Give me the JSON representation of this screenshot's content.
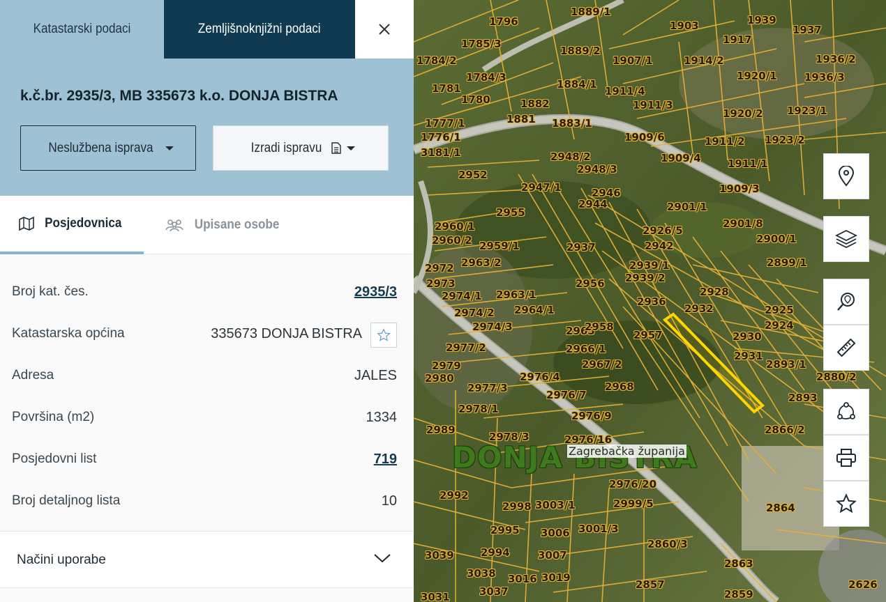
{
  "tabs": {
    "cadastral": "Katastarski podaci",
    "land_registry": "Zemljišnoknjižni podaci"
  },
  "parcel": {
    "title": "k.č.br. 2935/3, MB 335673 k.o. DONJA BISTRA"
  },
  "actions": {
    "unofficial_doc": "Neslužbena isprava",
    "create_doc": "Izradi ispravu"
  },
  "subtabs": {
    "possession": "Posjedovnica",
    "persons": "Upisane osobe"
  },
  "info": {
    "rows": [
      {
        "label": "Broj kat. čes.",
        "value": "2935/3"
      },
      {
        "label": "Katastarska općina",
        "value": "335673 DONJA BISTRA"
      },
      {
        "label": "Adresa",
        "value": "JALES"
      },
      {
        "label": "Površina (m2)",
        "value": "1334"
      },
      {
        "label": "Posjedovni list",
        "value": "719"
      },
      {
        "label": "Broj detaljnog lista",
        "value": "10"
      }
    ]
  },
  "accordion": {
    "usage_label": "Načini uporabe"
  },
  "map": {
    "town_label": "DONJA BISTRA",
    "county_label": "Zagrebačka županija",
    "parcel_labels": [
      "1796",
      "1889/1",
      "1903",
      "1939",
      "1937",
      "1785/3",
      "1889/2",
      "1907/1",
      "1914/2",
      "1917",
      "1936/2",
      "1784/2",
      "1784/3",
      "1884/1",
      "1911/4",
      "1920/1",
      "1936/3",
      "1781",
      "1780",
      "1882",
      "1911/3",
      "1920/2",
      "1923/1",
      "1777/1",
      "1881",
      "1883/1",
      "1909/6",
      "1911/2",
      "1923/2",
      "1776/1",
      "3181/1",
      "2948/2",
      "1909/4",
      "1911/1",
      "2952",
      "2948/3",
      "1909/3",
      "2947/1",
      "2946",
      "2901/1",
      "2944",
      "2955",
      "2926/5",
      "2901/8",
      "2960/1",
      "2942",
      "2900/1",
      "2960/2",
      "2959/1",
      "2937",
      "2963/2",
      "2939/1",
      "2899/1",
      "2972",
      "2939/2",
      "2973",
      "2956",
      "2928",
      "2974/1",
      "2963/1",
      "2936",
      "2932",
      "2925",
      "2974/2",
      "2964/1",
      "2924",
      "2974/3",
      "2965",
      "2958",
      "2957",
      "2930",
      "2977/2",
      "2966/1",
      "2931",
      "2893/1",
      "2979",
      "2967/2",
      "2980",
      "2976/4",
      "2880/2",
      "2968",
      "2977/3",
      "2976/7",
      "2893",
      "2978/1",
      "2976/9",
      "2989",
      "2978/3",
      "2976/16",
      "2866/2",
      "2976/20",
      "2992",
      "2998",
      "3003/1",
      "2999/5",
      "2864",
      "2995",
      "3006",
      "3001/3",
      "2860/3",
      "3039",
      "2994",
      "3007",
      "2863",
      "3038",
      "3016",
      "3019",
      "2857",
      "2626",
      "3031",
      "3037",
      "2859"
    ],
    "colors": {
      "parcel_line": "#e8b033",
      "selected_parcel": "#ffd400"
    }
  },
  "toolbar": {
    "icons": [
      "location-pin-icon",
      "layers-icon",
      "search-location-icon",
      "ruler-icon",
      "polygon-icon",
      "print-icon",
      "star-icon"
    ]
  },
  "colors": {
    "header_bg": "#9fc1d4",
    "active_tab_bg": "#0f3a52",
    "link": "#163a4f"
  }
}
